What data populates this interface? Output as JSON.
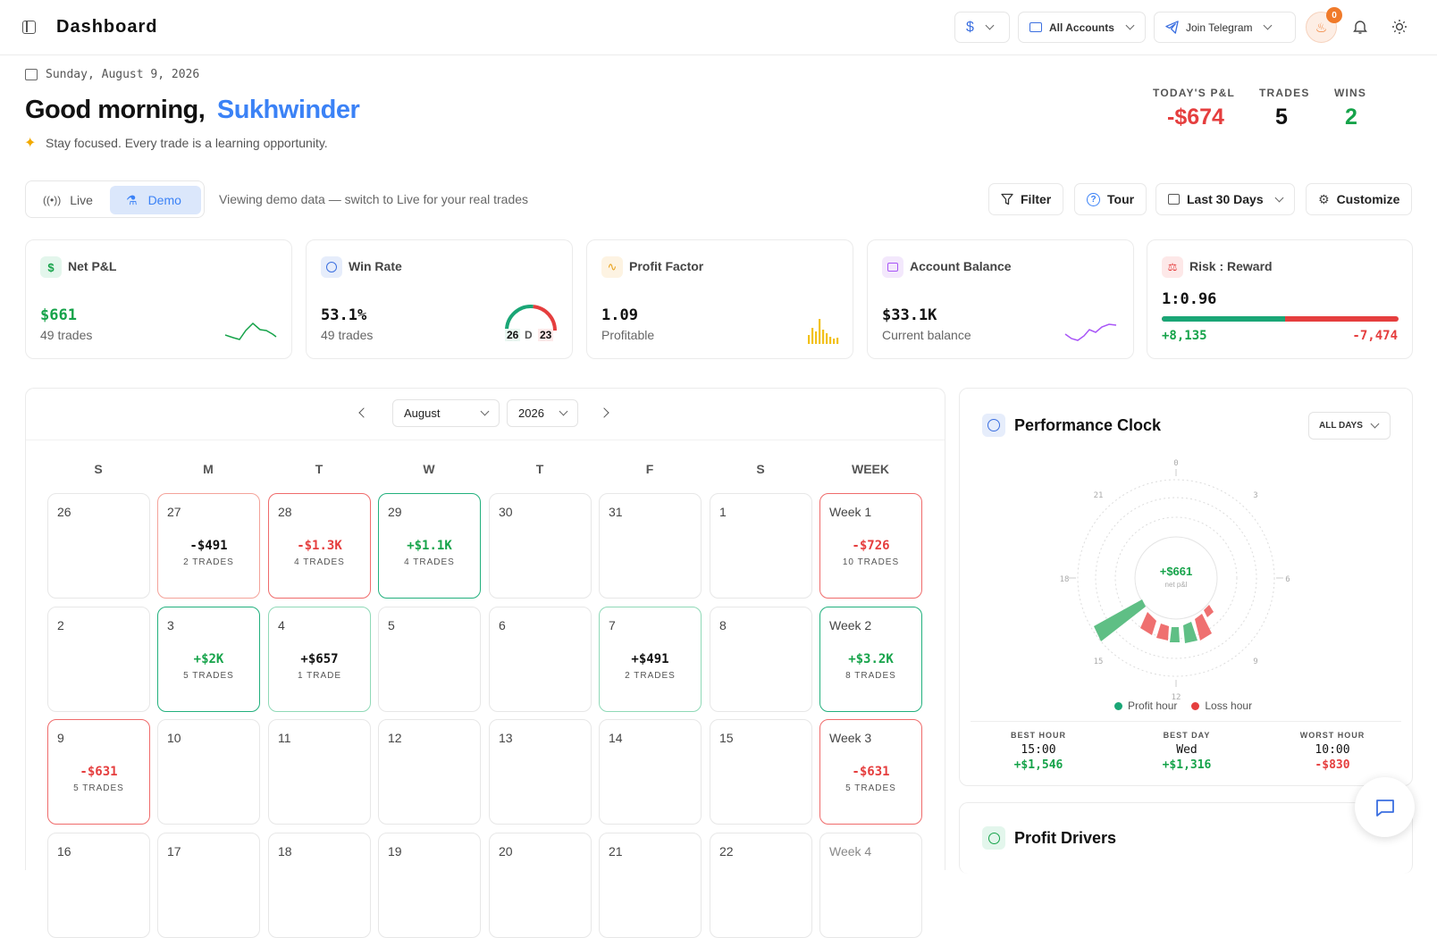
{
  "header": {
    "title": "Dashboard",
    "currency_symbol": "$",
    "accounts_label": "All Accounts",
    "telegram_label": "Join Telegram",
    "streak_badge": "0"
  },
  "greeting": {
    "date": "Sunday, August 9, 2026",
    "hello": "Good morning,",
    "name": "Sukhwinder",
    "tagline": "Stay focused. Every trade is a learning opportunity."
  },
  "today": {
    "pnl_label": "TODAY'S P&L",
    "pnl_value": "-$674",
    "trades_label": "TRADES",
    "trades_value": "5",
    "wins_label": "WINS",
    "wins_value": "2"
  },
  "mode": {
    "live_label": "Live",
    "demo_label": "Demo",
    "active": "Demo",
    "note": "Viewing demo data — switch to Live for your real trades"
  },
  "toolbar": {
    "filter_label": "Filter",
    "tour_label": "Tour",
    "range_label": "Last 30 Days",
    "customize_label": "Customize"
  },
  "stats": {
    "net_pnl": {
      "title": "Net P&L",
      "value": "$661",
      "sub": "49 trades"
    },
    "win_rate": {
      "title": "Win Rate",
      "value": "53.1%",
      "sub": "49 trades",
      "wins": "26",
      "draws": "D",
      "losses": "23",
      "win_fraction": 0.531
    },
    "profit_factor": {
      "title": "Profit Factor",
      "value": "1.09",
      "sub": "Profitable"
    },
    "balance": {
      "title": "Account Balance",
      "value": "$33.1K",
      "sub": "Current balance"
    },
    "risk_reward": {
      "title": "Risk : Reward",
      "value": "1:0.96",
      "gain": "+8,135",
      "loss": "-7,474",
      "gain_fraction": 0.52
    }
  },
  "calendar": {
    "month": "August",
    "year": "2026",
    "headers": [
      "S",
      "M",
      "T",
      "W",
      "T",
      "F",
      "S",
      "WEEK"
    ],
    "rows": [
      [
        {
          "d": "26"
        },
        {
          "d": "27",
          "p": "-$491",
          "t": "2 TRADES",
          "s": "negl"
        },
        {
          "d": "28",
          "p": "-$1.3K",
          "t": "4 TRADES",
          "s": "neg"
        },
        {
          "d": "29",
          "p": "+$1.1K",
          "t": "4 TRADES",
          "s": "pos"
        },
        {
          "d": "30"
        },
        {
          "d": "31"
        },
        {
          "d": "1"
        },
        {
          "d": "Week 1",
          "p": "-$726",
          "t": "10 TRADES",
          "s": "neg"
        }
      ],
      [
        {
          "d": "2"
        },
        {
          "d": "3",
          "p": "+$2K",
          "t": "5 TRADES",
          "s": "pos"
        },
        {
          "d": "4",
          "p": "+$657",
          "t": "1 TRADE",
          "s": "posl"
        },
        {
          "d": "5"
        },
        {
          "d": "6"
        },
        {
          "d": "7",
          "p": "+$491",
          "t": "2 TRADES",
          "s": "posl"
        },
        {
          "d": "8"
        },
        {
          "d": "Week 2",
          "p": "+$3.2K",
          "t": "8 TRADES",
          "s": "pos"
        }
      ],
      [
        {
          "d": "9",
          "p": "-$631",
          "t": "5 TRADES",
          "s": "neg"
        },
        {
          "d": "10"
        },
        {
          "d": "11"
        },
        {
          "d": "12"
        },
        {
          "d": "13"
        },
        {
          "d": "14"
        },
        {
          "d": "15"
        },
        {
          "d": "Week 3",
          "p": "-$631",
          "t": "5 TRADES",
          "s": "neg"
        }
      ],
      [
        {
          "d": "16"
        },
        {
          "d": "17"
        },
        {
          "d": "18"
        },
        {
          "d": "19"
        },
        {
          "d": "20"
        },
        {
          "d": "21"
        },
        {
          "d": "22"
        },
        {
          "d": "Week 4"
        }
      ]
    ]
  },
  "clock": {
    "title": "Performance Clock",
    "filter": "ALL DAYS",
    "center_value": "+$661",
    "center_label": "net p&l",
    "hour_labels": [
      "0",
      "3",
      "6",
      "9",
      "12",
      "15",
      "18",
      "21"
    ],
    "legend_profit": "Profit hour",
    "legend_loss": "Loss hour",
    "best_hour_label": "BEST HOUR",
    "best_hour": "15:00",
    "best_hour_value": "+$1,546",
    "best_day_label": "BEST DAY",
    "best_day": "Wed",
    "best_day_value": "+$1,316",
    "worst_hour_label": "WORST HOUR",
    "worst_hour": "10:00",
    "worst_hour_value": "-$830"
  },
  "drivers": {
    "title": "Profit Drivers"
  },
  "colors": {
    "profit": "#16a34a",
    "loss": "#e53e3e",
    "accent": "#3b82f6"
  }
}
